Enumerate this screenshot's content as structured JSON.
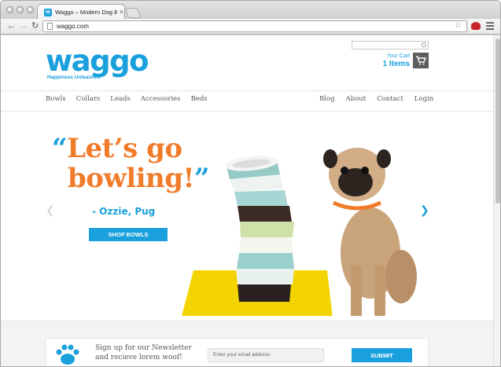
{
  "browser": {
    "tab_title": "Waggo – Modern Dog Bowls",
    "tab_favicon": "w",
    "url": "waggo.com"
  },
  "header": {
    "logo_text": "waggo",
    "logo_tagline": "Happiness Unleashed",
    "search_placeholder": "",
    "cart_label": "Your Cart",
    "cart_count": "1 Items"
  },
  "nav": {
    "left": [
      "Bowls",
      "Collars",
      "Leads",
      "Accessories",
      "Beds"
    ],
    "right": [
      "Blog",
      "About",
      "Contact",
      "Login"
    ]
  },
  "hero": {
    "quote_open": "“",
    "quote_line1": "Let’s go",
    "quote_line2": "bowling!",
    "quote_close": "”",
    "attribution": "- Ozzie, Pug",
    "cta_label": "SHOP BOWLS",
    "prev_arrow": "❮",
    "next_arrow": "❯"
  },
  "newsletter": {
    "line1": "Sign up for our Newsletter",
    "line2": "and recieve lorem woof!",
    "email_placeholder": "Enter your email address",
    "submit_label": "SUBMIT"
  },
  "colors": {
    "brand_blue": "#1aa0dc",
    "accent_orange": "#f07c2b",
    "mat_yellow": "#f3d400"
  },
  "icons": [
    "back-arrow-icon",
    "forward-arrow-icon",
    "reload-icon",
    "page-icon",
    "star-icon",
    "cart-icon",
    "search-icon",
    "paw-icon"
  ]
}
